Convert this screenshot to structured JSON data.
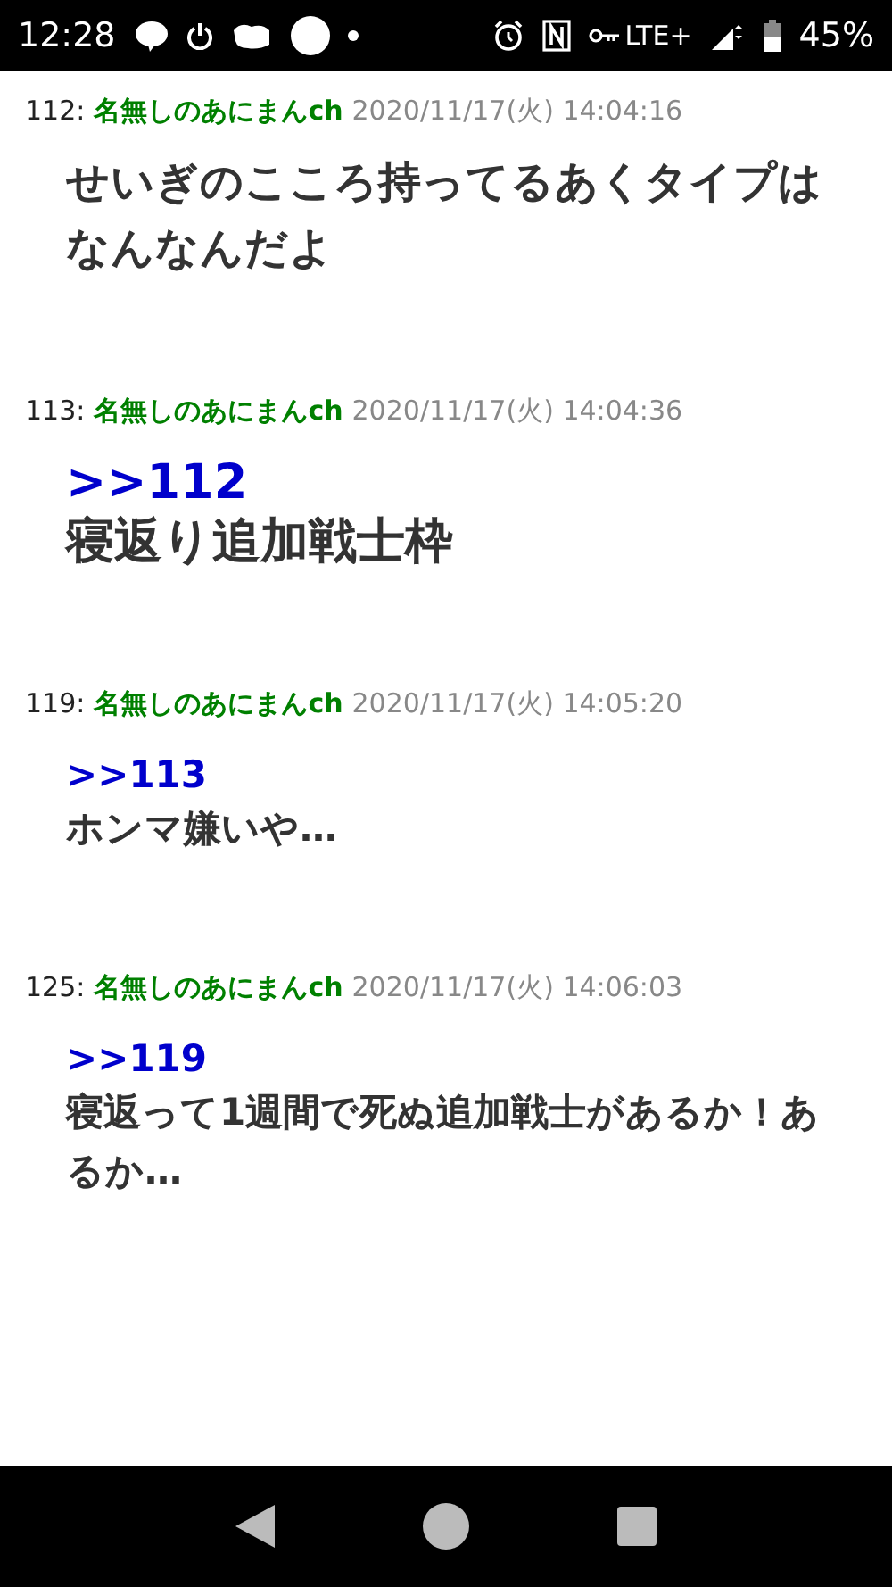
{
  "status_bar": {
    "time": "12:28",
    "network": "LTE+",
    "battery": "45%"
  },
  "posts": [
    {
      "number": "112:",
      "name": "名無しのあにまんch",
      "date": "2020/11/17(火) 14:04:16",
      "body": "せいぎのこころ持ってるあくタイプはなんなんだよ",
      "kind": "normal"
    },
    {
      "number": "113:",
      "name": "名無しのあにまんch",
      "date": "2020/11/17(火) 14:04:36",
      "quote": ">>112",
      "body": "寝返り追加戦士枠",
      "kind": "large"
    },
    {
      "number": "119:",
      "name": "名無しのあにまんch",
      "date": "2020/11/17(火) 14:05:20",
      "quote": ">>113",
      "body": "ホンマ嫌いや…",
      "kind": "small"
    },
    {
      "number": "125:",
      "name": "名無しのあにまんch",
      "date": "2020/11/17(火) 14:06:03",
      "quote": ">>119",
      "body": "寝返って1週間で死ぬ追加戦士があるか！あるか…",
      "kind": "small"
    }
  ]
}
